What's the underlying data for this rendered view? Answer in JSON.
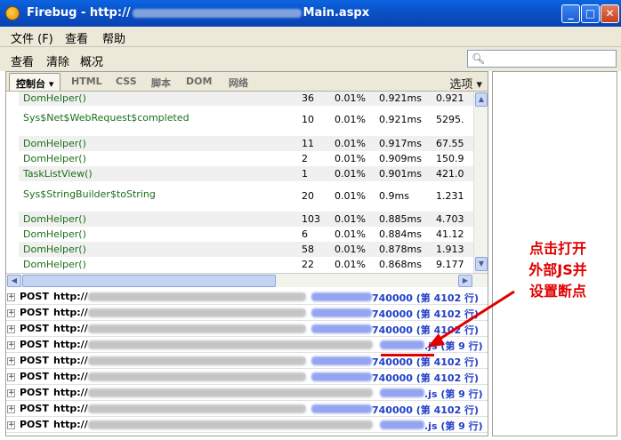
{
  "window": {
    "title_prefix": "Firebug - http://",
    "title_suffix": "Main.aspx",
    "minimize": "_",
    "maximize": "□",
    "close": "✕"
  },
  "menu": {
    "file": "文件 (F)",
    "view": "查看",
    "help": "帮助"
  },
  "toolbar": {
    "inspect": "查看",
    "clear": "清除",
    "profile": "概况",
    "search_icon": "search-icon"
  },
  "tabs": {
    "console": "控制台 ▾",
    "html": "HTML",
    "css": "CSS",
    "script": "脚本",
    "dom": "DOM",
    "net": "网络",
    "options": "选项 ▾"
  },
  "profile_rows": [
    {
      "fn": "DomHelper()",
      "calls": "36",
      "percent": "0.01%",
      "time": "0.921ms",
      "own": "0.921"
    },
    {
      "fn": "Sys$Net$WebRequest$completed",
      "calls": "10",
      "percent": "0.01%",
      "time": "0.921ms",
      "own": "5295."
    },
    {
      "fn": "DomHelper()",
      "calls": "11",
      "percent": "0.01%",
      "time": "0.917ms",
      "own": "67.55"
    },
    {
      "fn": "DomHelper()",
      "calls": "2",
      "percent": "0.01%",
      "time": "0.909ms",
      "own": "150.9"
    },
    {
      "fn": "TaskListView()",
      "calls": "1",
      "percent": "0.01%",
      "time": "0.901ms",
      "own": "421.0"
    },
    {
      "fn": "Sys$StringBuilder$toString",
      "calls": "20",
      "percent": "0.01%",
      "time": "0.9ms",
      "own": "1.231"
    },
    {
      "fn": "DomHelper()",
      "calls": "103",
      "percent": "0.01%",
      "time": "0.885ms",
      "own": "4.703"
    },
    {
      "fn": "DomHelper()",
      "calls": "6",
      "percent": "0.01%",
      "time": "0.884ms",
      "own": "41.12"
    },
    {
      "fn": "DomHelper()",
      "calls": "58",
      "percent": "0.01%",
      "time": "0.878ms",
      "own": "1.913"
    },
    {
      "fn": "DomHelper()",
      "calls": "22",
      "percent": "0.01%",
      "time": "0.868ms",
      "own": "9.177"
    }
  ],
  "net_rows": [
    {
      "verb": "POST",
      "url": "http://",
      "loc": "740000 (第 4102 行)"
    },
    {
      "verb": "POST",
      "url": "http://",
      "loc": "740000 (第 4102 行)"
    },
    {
      "verb": "POST",
      "url": "http://",
      "loc": "740000 (第 4102 行)"
    },
    {
      "verb": "POST",
      "url": "http://",
      "loc": ".js (第 9 行)"
    },
    {
      "verb": "POST",
      "url": "http://",
      "loc": "740000 (第 4102 行)"
    },
    {
      "verb": "POST",
      "url": "http://",
      "loc": "740000 (第 4102 行)"
    },
    {
      "verb": "POST",
      "url": "http://",
      "loc": ".js (第 9 行)"
    },
    {
      "verb": "POST",
      "url": "http://",
      "loc": "740000 (第 4102 行)"
    },
    {
      "verb": "POST",
      "url": "http://",
      "loc": ".js (第 9 行)"
    }
  ],
  "annotation": {
    "line1": "点击打开",
    "line2": "外部JS并",
    "line3": "设置断点"
  },
  "colors": {
    "annotation": "#e00000",
    "title_bar": "#0a4fc4",
    "fn_green": "#1a6f1a",
    "link_blue": "#1f3fc9"
  }
}
